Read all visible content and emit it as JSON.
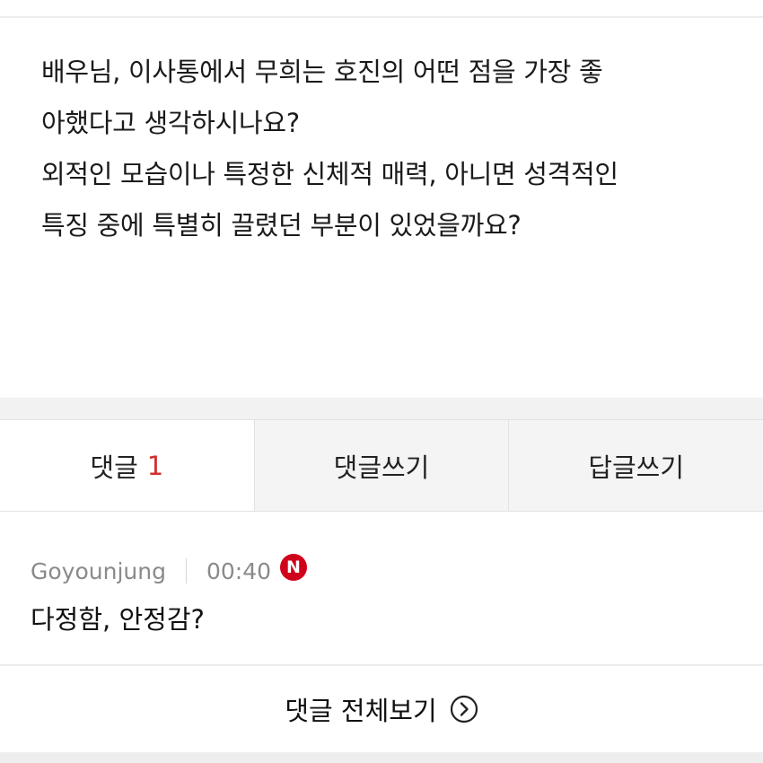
{
  "post": {
    "lines": [
      "배우님, 이사통에서 무희는 호진의 어떤 점을 가장 좋",
      "아했다고 생각하시나요?",
      "외적인 모습이나 특정한 신체적 매력, 아니면 성격적인",
      "특징 중에 특별히 끌렸던 부분이 있었을까요?"
    ]
  },
  "tabs": {
    "comments_label": "댓글",
    "comments_count": "1",
    "write_comment_label": "댓글쓰기",
    "write_reply_label": "답글쓰기"
  },
  "comment": {
    "author": "Goyounjung",
    "time": "00:40",
    "new_badge": "N",
    "text": "다정함, 안정감?"
  },
  "footer": {
    "view_all_label": "댓글 전체보기",
    "view_all_icon": "chevron-right-circle-icon"
  },
  "colors": {
    "accent_red": "#d32f2f",
    "badge_red": "#d0021b",
    "meta_gray": "#8a8a8a"
  }
}
